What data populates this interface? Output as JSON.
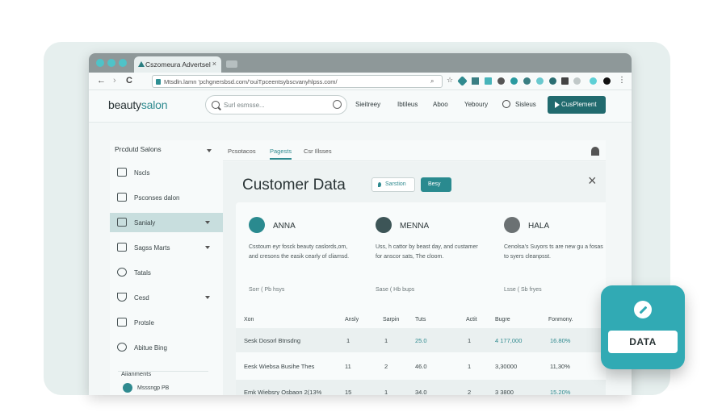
{
  "browser": {
    "tab_title": "Cszomeura Advertsel",
    "url": "Mtsdln.lamn 'pchgnersbsd.com/'ouiTpceentsybscvanyhlpss.com/",
    "nav": {
      "back": "←",
      "forward": "›",
      "reload": "C"
    }
  },
  "site": {
    "logo_left": "beauty",
    "logo_right": "salon",
    "search_placeholder": "Surl esmsse...",
    "nav_items": [
      "Sieitreey",
      "Ibtileus",
      "Aboo",
      "Yeboury",
      "Sisleus"
    ],
    "cta_label": "CusPlement"
  },
  "sidebar": {
    "title": "Prcdutd Salons",
    "items": [
      {
        "label": "Nscls",
        "icon": "folder-icon"
      },
      {
        "label": "Psconses dalon",
        "icon": "chat-icon"
      },
      {
        "label": "Sanialy",
        "icon": "document-icon"
      },
      {
        "label": "Sagss Marts",
        "icon": "calendar-icon"
      },
      {
        "label": "Tatals",
        "icon": "clock-icon"
      },
      {
        "label": "Cesd",
        "icon": "filter-icon"
      },
      {
        "label": "Protsle",
        "icon": "home-icon"
      },
      {
        "label": "Abitue Bing",
        "icon": "help-icon"
      }
    ],
    "section_label": "Aiianments",
    "sub_item": "Msssngp PB"
  },
  "content": {
    "tabs": [
      "Pcsotacos",
      "Pagests",
      "Csr Illsses"
    ],
    "title": "Customer Data",
    "pill_secondary": "Sarstion",
    "pill_primary": "Besy",
    "customers": [
      {
        "name": "ANNA",
        "desc": "Csstoum eyr fosck beauty caslords,om, and cresons the easik cearly of cliamsd.",
        "meta": "Sorr ( Pb hsys"
      },
      {
        "name": "MENNA",
        "desc": "Uss, h cattor by beast day, and custamer for anscor sats, The cloom.",
        "meta": "Sase ( Hb bups"
      },
      {
        "name": "HALA",
        "desc": "Cenolsa's Suyors ts are new gu a fosas to syers cleanpsst.",
        "meta": "Lsse ( Sb fryes"
      }
    ],
    "table": {
      "headers": [
        "Xon",
        "Ansly",
        "Sarpin",
        "Tuts",
        "Actit",
        "Bugre",
        "Fonmony."
      ],
      "rows": [
        [
          "Sesk Dosorl Btnsdng",
          "1",
          "1",
          "25.0",
          "1",
          "4 177,000",
          "16.80%"
        ],
        [
          "Eesk Wiebsa Busihe Thes",
          "11",
          "2",
          "46.0",
          "1",
          "3,30000",
          "11,30%"
        ],
        [
          "Emk Wiebsry Osbaon 2(13%",
          "15",
          "1",
          "34.0",
          "2",
          "3 3800",
          "15.20%"
        ]
      ]
    }
  },
  "floating_badge": {
    "label": "DATA",
    "icon": "pencil-icon"
  },
  "colors": {
    "accent": "#2f8a8f",
    "badge": "#31aab4",
    "cta": "#216a6e"
  }
}
